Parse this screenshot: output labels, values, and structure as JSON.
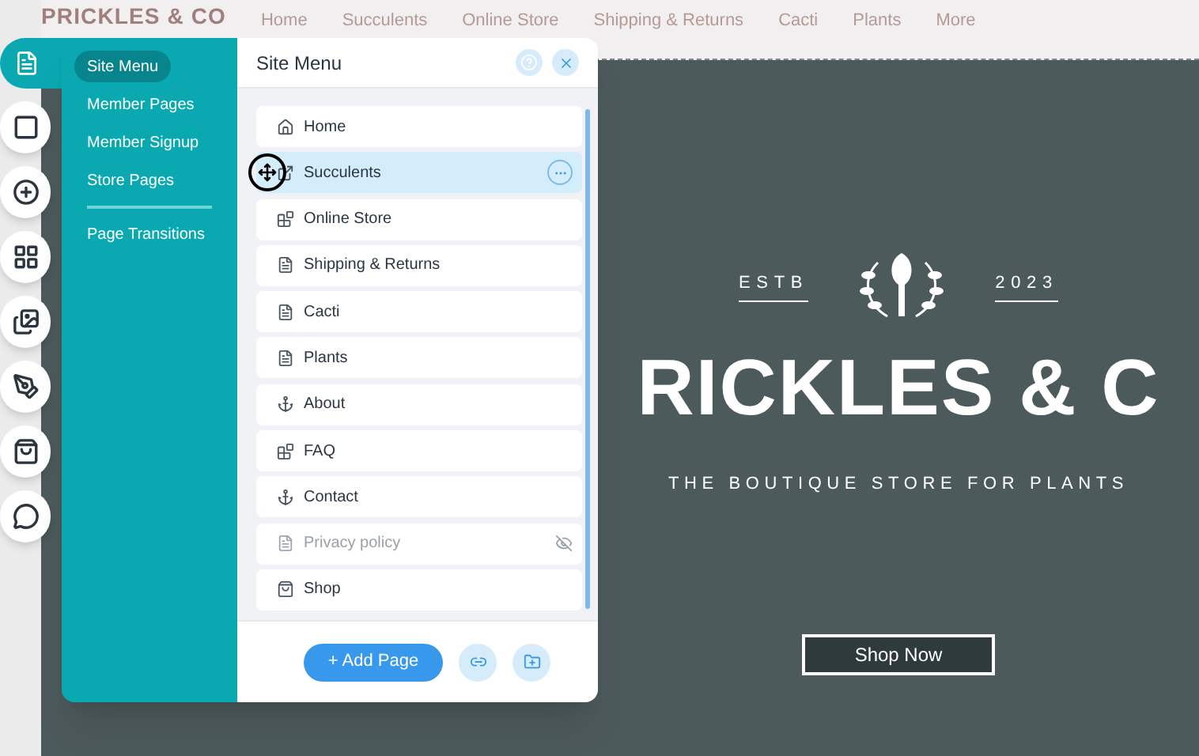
{
  "site": {
    "logo": "PRICKLES & CO",
    "nav": [
      {
        "label": "Home"
      },
      {
        "label": "Succulents"
      },
      {
        "label": "Online Store"
      },
      {
        "label": "Shipping & Returns"
      },
      {
        "label": "Cacti"
      },
      {
        "label": "Plants"
      },
      {
        "label": "More"
      }
    ],
    "hero": {
      "estb": "ESTB",
      "year": "2023",
      "title": "RICKLES & C",
      "tagline": "THE BOUTIQUE STORE FOR PLANTS",
      "button": "Shop Now"
    }
  },
  "toolbar": [
    {
      "kind": "pages",
      "selected": true
    },
    {
      "kind": "background",
      "selected": false
    },
    {
      "kind": "add",
      "selected": false
    },
    {
      "kind": "apps",
      "selected": false
    },
    {
      "kind": "media",
      "selected": false
    },
    {
      "kind": "blog",
      "selected": false
    },
    {
      "kind": "store",
      "selected": false
    },
    {
      "kind": "chat",
      "selected": false
    }
  ],
  "panel": {
    "tabs": [
      {
        "label": "Site Menu",
        "selected": true
      },
      {
        "label": "Member Pages",
        "selected": false
      },
      {
        "label": "Member Signup",
        "selected": false
      },
      {
        "label": "Store Pages",
        "selected": false
      },
      {
        "label": "Page Transitions",
        "selected": false
      }
    ],
    "title": "Site Menu",
    "pages": [
      {
        "label": "Home",
        "kind": "home",
        "selected": false,
        "hidden": false
      },
      {
        "label": "Succulents",
        "kind": "link",
        "selected": true,
        "hidden": false
      },
      {
        "label": "Online Store",
        "kind": "store",
        "selected": false,
        "hidden": false
      },
      {
        "label": "Shipping & Returns",
        "kind": "page",
        "selected": false,
        "hidden": false
      },
      {
        "label": "Cacti",
        "kind": "page",
        "selected": false,
        "hidden": false
      },
      {
        "label": "Plants",
        "kind": "page",
        "selected": false,
        "hidden": false
      },
      {
        "label": "About",
        "kind": "anchor",
        "selected": false,
        "hidden": false
      },
      {
        "label": "FAQ",
        "kind": "store",
        "selected": false,
        "hidden": false
      },
      {
        "label": "Contact",
        "kind": "anchor",
        "selected": false,
        "hidden": false
      },
      {
        "label": "Privacy policy",
        "kind": "page",
        "selected": false,
        "hidden": true
      },
      {
        "label": "Shop",
        "kind": "shop",
        "selected": false,
        "hidden": false
      }
    ],
    "add_button": "+ Add Page"
  }
}
